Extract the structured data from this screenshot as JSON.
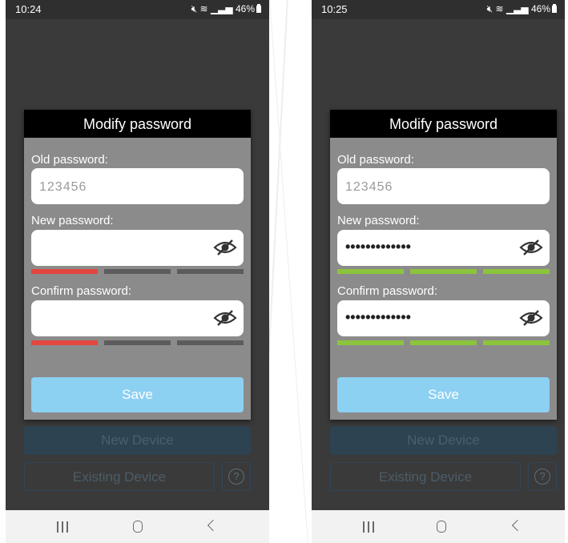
{
  "left": {
    "status": {
      "time": "10:24",
      "battery": "46%"
    },
    "dialog": {
      "title": "Modify password",
      "old_label": "Old password:",
      "old_value": "123456",
      "new_label": "New password:",
      "new_value": "",
      "confirm_label": "Confirm password:",
      "confirm_value": "",
      "new_strength": [
        "red",
        "gray",
        "gray"
      ],
      "confirm_strength": [
        "red",
        "gray",
        "gray"
      ],
      "save_label": "Save"
    },
    "new_device_label": "New Device",
    "existing_device_label": "Existing Device",
    "help_label": "?"
  },
  "right": {
    "status": {
      "time": "10:25",
      "battery": "46%"
    },
    "dialog": {
      "title": "Modify password",
      "old_label": "Old password:",
      "old_value": "123456",
      "new_label": "New password:",
      "new_value": "•••••••••••••",
      "confirm_label": "Confirm password:",
      "confirm_value": "•••••••••••••",
      "new_strength": [
        "green",
        "green",
        "green"
      ],
      "confirm_strength": [
        "green",
        "green",
        "green"
      ],
      "save_label": "Save"
    },
    "new_device_label": "New Device",
    "existing_device_label": "Existing Device",
    "help_label": "?"
  },
  "colors": {
    "red": "#e2463f",
    "gray": "#5c5c5c",
    "green": "#8cc43c",
    "save": "#8cd0f2"
  },
  "icons": [
    "hide-password-eye-icon",
    "help-circle-icon",
    "nav-recents-icon",
    "nav-home-icon",
    "nav-back-icon",
    "wifi-icon",
    "signal-icon",
    "battery-icon"
  ]
}
